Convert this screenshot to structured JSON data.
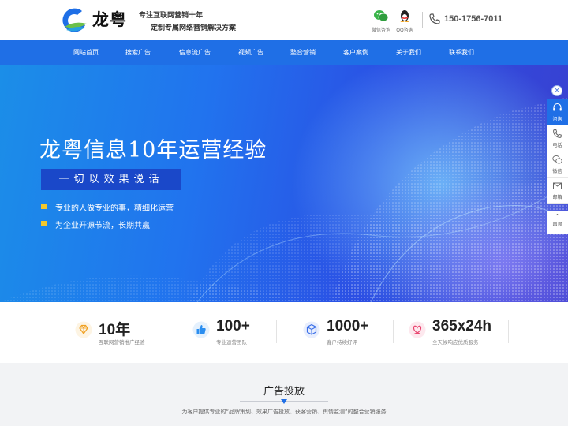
{
  "header": {
    "logo_text": "龙粤",
    "slogan_line1": "专注互联网营销十年",
    "slogan_line2": "定制专属网络营销解决方案",
    "wechat_label": "微信咨询",
    "qq_label": "QQ咨询",
    "phone": "150-1756-7011"
  },
  "nav": {
    "items": [
      "网站首页",
      "搜索广告",
      "信息流广告",
      "视频广告",
      "整合营销",
      "客户案例",
      "关于我们",
      "联系我们"
    ]
  },
  "banner": {
    "title": "龙粤信息10年运营经验",
    "tag": "一切以效果说话",
    "bullets": [
      "专业的人做专业的事，精细化运营",
      "为企业开源节流，长期共赢"
    ]
  },
  "side_panel": {
    "close_glyph": "×",
    "items": [
      {
        "label": "咨询",
        "icon": "headset-icon"
      },
      {
        "label": "电话",
        "icon": "phone-icon"
      },
      {
        "label": "微信",
        "icon": "wechat-icon"
      },
      {
        "label": "邮箱",
        "icon": "mail-icon"
      }
    ],
    "top_arrow": "⌃",
    "top_label": "回顶"
  },
  "stats": [
    {
      "value": "10年",
      "label": "互联网营销推广经验",
      "icon": "diamond-icon",
      "color": "#f0a020"
    },
    {
      "value": "100+",
      "label": "专业运营团队",
      "icon": "thumbs-up-icon",
      "color": "#2b8ef0"
    },
    {
      "value": "1000+",
      "label": "客户持续好评",
      "icon": "cube-icon",
      "color": "#3a6fe8"
    },
    {
      "value": "365x24h",
      "label": "全天候响应优质服务",
      "icon": "flower-icon",
      "color": "#e8436e"
    }
  ],
  "section": {
    "title": "广告投放",
    "description": "为客户提供专业的“品牌策划、效果广告投放、获客营销、舆情监测”的整合营销服务"
  },
  "colors": {
    "brand_blue": "#1f6fe6",
    "accent_yellow": "#f3c82c"
  }
}
